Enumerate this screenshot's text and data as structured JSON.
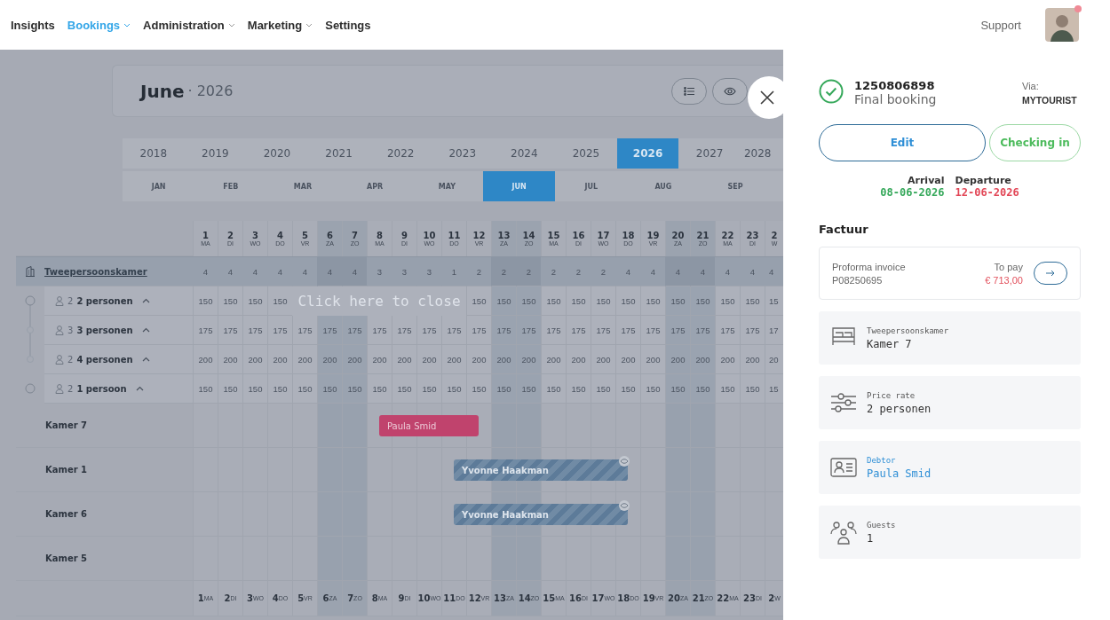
{
  "nav": {
    "items": [
      {
        "label": "Insights",
        "selected": false,
        "dropdown": false
      },
      {
        "label": "Bookings",
        "selected": true,
        "dropdown": true
      },
      {
        "label": "Administration",
        "selected": false,
        "dropdown": true
      },
      {
        "label": "Marketing",
        "selected": false,
        "dropdown": true
      },
      {
        "label": "Settings",
        "selected": false,
        "dropdown": false
      }
    ],
    "support": "Support",
    "avatar": {
      "notification": true
    }
  },
  "calendar": {
    "month": "June",
    "year_label": "· 2026",
    "years": [
      {
        "label": "2018",
        "selected": false
      },
      {
        "label": "2019",
        "selected": false
      },
      {
        "label": "2020",
        "selected": false
      },
      {
        "label": "2021",
        "selected": false
      },
      {
        "label": "2022",
        "selected": false
      },
      {
        "label": "2023",
        "selected": false
      },
      {
        "label": "2024",
        "selected": false
      },
      {
        "label": "2025",
        "selected": false
      },
      {
        "label": "2026",
        "selected": true
      },
      {
        "label": "2027",
        "selected": false
      },
      {
        "label": "2028",
        "selected": false
      }
    ],
    "months": [
      {
        "label": "JAN",
        "selected": false
      },
      {
        "label": "FEB",
        "selected": false
      },
      {
        "label": "MAR",
        "selected": false
      },
      {
        "label": "APR",
        "selected": false
      },
      {
        "label": "MAY",
        "selected": false
      },
      {
        "label": "JUN",
        "selected": true
      },
      {
        "label": "JUL",
        "selected": false
      },
      {
        "label": "AUG",
        "selected": false
      },
      {
        "label": "SEP",
        "selected": false
      }
    ],
    "days": [
      {
        "num": "1",
        "wd": "MA",
        "weekend": false
      },
      {
        "num": "2",
        "wd": "DI",
        "weekend": false
      },
      {
        "num": "3",
        "wd": "WO",
        "weekend": false
      },
      {
        "num": "4",
        "wd": "DO",
        "weekend": false
      },
      {
        "num": "5",
        "wd": "VR",
        "weekend": false
      },
      {
        "num": "6",
        "wd": "ZA",
        "weekend": true
      },
      {
        "num": "7",
        "wd": "ZO",
        "weekend": true
      },
      {
        "num": "8",
        "wd": "MA",
        "weekend": false
      },
      {
        "num": "9",
        "wd": "DI",
        "weekend": false
      },
      {
        "num": "10",
        "wd": "WO",
        "weekend": false
      },
      {
        "num": "11",
        "wd": "DO",
        "weekend": false
      },
      {
        "num": "12",
        "wd": "VR",
        "weekend": false
      },
      {
        "num": "13",
        "wd": "ZA",
        "weekend": true
      },
      {
        "num": "14",
        "wd": "ZO",
        "weekend": true
      },
      {
        "num": "15",
        "wd": "MA",
        "weekend": false
      },
      {
        "num": "16",
        "wd": "DI",
        "weekend": false
      },
      {
        "num": "17",
        "wd": "WO",
        "weekend": false
      },
      {
        "num": "18",
        "wd": "DO",
        "weekend": false
      },
      {
        "num": "19",
        "wd": "VR",
        "weekend": false
      },
      {
        "num": "20",
        "wd": "ZA",
        "weekend": true
      },
      {
        "num": "21",
        "wd": "ZO",
        "weekend": true
      },
      {
        "num": "22",
        "wd": "MA",
        "weekend": false
      },
      {
        "num": "23",
        "wd": "DI",
        "weekend": false
      },
      {
        "num": "2",
        "wd": "W",
        "weekend": false
      }
    ],
    "group": {
      "name": "Tweepersoonskamer",
      "availability": [
        "4",
        "4",
        "4",
        "4",
        "4",
        "4",
        "4",
        "3",
        "3",
        "3",
        "1",
        "2",
        "2",
        "2",
        "2",
        "2",
        "2",
        "4",
        "4",
        "4",
        "4",
        "4",
        "4",
        "4"
      ]
    },
    "rates": [
      {
        "kind": "parent",
        "guests": "2",
        "name": "2 personen",
        "prices_before": [
          "150",
          "150",
          "150",
          "150"
        ],
        "prices_after": [
          "150",
          "150",
          "150",
          "150",
          "150",
          "150",
          "150",
          "150",
          "150",
          "150",
          "150",
          "150",
          "15"
        ]
      },
      {
        "kind": "child",
        "guests": "3",
        "name": "3 personen",
        "prices": [
          "175",
          "175",
          "175",
          "175",
          "175",
          "175",
          "175",
          "175",
          "175",
          "175",
          "175",
          "175",
          "175",
          "175",
          "175",
          "175",
          "175",
          "175",
          "175",
          "175",
          "175",
          "175",
          "175",
          "17"
        ]
      },
      {
        "kind": "last-child",
        "guests": "2",
        "name": "4 personen",
        "prices": [
          "200",
          "200",
          "200",
          "200",
          "200",
          "200",
          "200",
          "200",
          "200",
          "200",
          "200",
          "200",
          "200",
          "200",
          "200",
          "200",
          "200",
          "200",
          "200",
          "200",
          "200",
          "200",
          "200",
          "20"
        ]
      },
      {
        "kind": "single",
        "guests": "2",
        "name": "1 persoon",
        "prices": [
          "150",
          "150",
          "150",
          "150",
          "150",
          "150",
          "150",
          "150",
          "150",
          "150",
          "150",
          "150",
          "150",
          "150",
          "150",
          "150",
          "150",
          "150",
          "150",
          "150",
          "150",
          "150",
          "150",
          "15"
        ]
      }
    ],
    "close_hint": "Click here to close",
    "rooms": [
      {
        "name": "Kamer 7",
        "bookings": [
          {
            "guest": "Paula Smid",
            "kind": "solid",
            "color": "#c0436d"
          }
        ]
      },
      {
        "name": "Kamer 1",
        "bookings": [
          {
            "guest": "Yvonne Haakman",
            "kind": "striped",
            "color": "#5d7b99"
          }
        ]
      },
      {
        "name": "Kamer 6",
        "bookings": [
          {
            "guest": "Yvonne Haakman",
            "kind": "striped",
            "color": "#5d7b99"
          }
        ]
      },
      {
        "name": "Kamer 5"
      }
    ],
    "footer_days": [
      {
        "num": "1",
        "wd": "MA",
        "weekend": false
      },
      {
        "num": "2",
        "wd": "DI",
        "weekend": false
      },
      {
        "num": "3",
        "wd": "WO",
        "weekend": false
      },
      {
        "num": "4",
        "wd": "DO",
        "weekend": false
      },
      {
        "num": "5",
        "wd": "VR",
        "weekend": false
      },
      {
        "num": "6",
        "wd": "ZA",
        "weekend": true
      },
      {
        "num": "7",
        "wd": "ZO",
        "weekend": true
      },
      {
        "num": "8",
        "wd": "MA",
        "weekend": false
      },
      {
        "num": "9",
        "wd": "DI",
        "weekend": false
      },
      {
        "num": "10",
        "wd": "WO",
        "weekend": false
      },
      {
        "num": "11",
        "wd": "DO",
        "weekend": false
      },
      {
        "num": "12",
        "wd": "VR",
        "weekend": false
      },
      {
        "num": "13",
        "wd": "ZA",
        "weekend": true
      },
      {
        "num": "14",
        "wd": "ZO",
        "weekend": true
      },
      {
        "num": "15",
        "wd": "MA",
        "weekend": false
      },
      {
        "num": "16",
        "wd": "DI",
        "weekend": false
      },
      {
        "num": "17",
        "wd": "WO",
        "weekend": false
      },
      {
        "num": "18",
        "wd": "DO",
        "weekend": false
      },
      {
        "num": "19",
        "wd": "VR",
        "weekend": false
      },
      {
        "num": "20",
        "wd": "ZA",
        "weekend": true
      },
      {
        "num": "21",
        "wd": "ZO",
        "weekend": true
      },
      {
        "num": "22",
        "wd": "MA",
        "weekend": false
      },
      {
        "num": "23",
        "wd": "DI",
        "weekend": false
      },
      {
        "num": "2",
        "wd": "W",
        "weekend": false
      }
    ]
  },
  "panel": {
    "booking_number": "1250806898",
    "status": "Final booking",
    "confirmed": true,
    "via_label": "Via:",
    "via": "MYTOURIST",
    "buttons": [
      {
        "label": "Edit",
        "kind": "primary"
      },
      {
        "label": "Checking in",
        "kind": "success"
      }
    ],
    "arrival_label": "Arrival",
    "arrival": "08-06-2026",
    "departure_label": "Departure",
    "departure": "12-06-2026",
    "invoice_title": "Factuur",
    "invoice": {
      "label": "Proforma invoice",
      "number": "P08250695",
      "pay_label": "To pay",
      "amount": "€ 713,00"
    },
    "cards": [
      {
        "kind": "room",
        "label": "Tweepersoonskamer",
        "value": "Kamer 7"
      },
      {
        "kind": "rate",
        "label": "Price rate",
        "value": "2 personen"
      },
      {
        "kind": "debtor",
        "label": "Debtor",
        "value": "Paula Smid"
      },
      {
        "kind": "guests",
        "label": "Guests",
        "value": "1"
      }
    ]
  }
}
